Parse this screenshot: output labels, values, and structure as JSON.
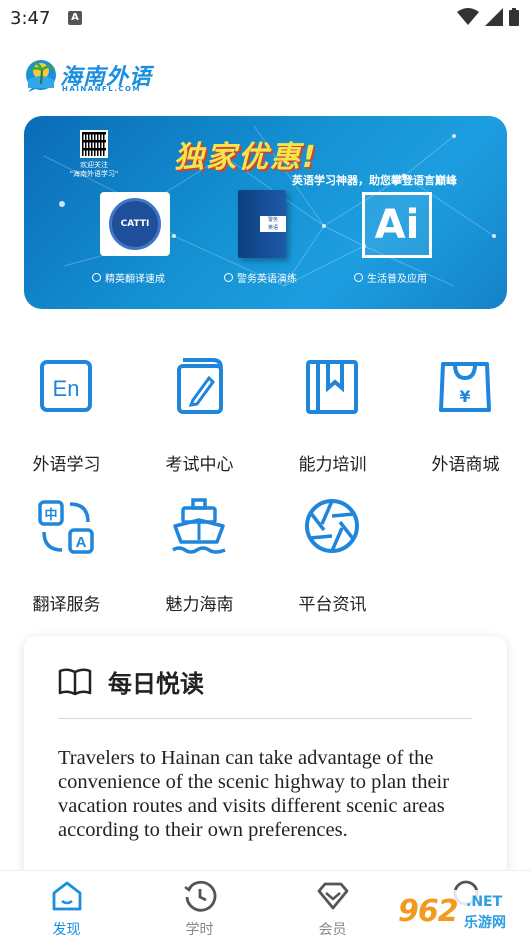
{
  "status_bar": {
    "time": "3:47",
    "notification_icon": "A"
  },
  "logo": {
    "name": "海南外语",
    "domain": "HAINANFL.COM"
  },
  "banner": {
    "qr_caption": "欢迎关注\n\"海南外语学习\"",
    "title": "独家优惠!",
    "slogan": "英语学习神器，助您攀登语言巅峰",
    "badge_text": "CATTI",
    "book_label": "警务\n英语",
    "ai_label": "Ai",
    "captions": [
      "精英翻译速成",
      "警务英语演练",
      "生活普及应用"
    ]
  },
  "menu": [
    {
      "label": "外语学习",
      "icon": "en-book-icon"
    },
    {
      "label": "考试中心",
      "icon": "exam-pencil-icon"
    },
    {
      "label": "能力培训",
      "icon": "bookmark-book-icon"
    },
    {
      "label": "外语商城",
      "icon": "shopping-bag-yen-icon"
    },
    {
      "label": "翻译服务",
      "icon": "translate-icon"
    },
    {
      "label": "魅力海南",
      "icon": "ship-icon"
    },
    {
      "label": "平台资讯",
      "icon": "aperture-icon"
    }
  ],
  "daily_reading": {
    "title": "每日悦读",
    "text": "Travelers to Hainan can take advantage of the convenience of the scenic highway to plan their vacation routes and visits different scenic areas according to their own preferences."
  },
  "bottom_nav": [
    {
      "label": "发现",
      "icon": "home-icon",
      "active": true
    },
    {
      "label": "学时",
      "icon": "history-clock-icon",
      "active": false
    },
    {
      "label": "会员",
      "icon": "diamond-icon",
      "active": false
    },
    {
      "label": "",
      "icon": "profile-icon",
      "active": false
    }
  ],
  "watermark": {
    "number": "962",
    "suffix": ".NET",
    "cn": "乐游网"
  },
  "colors": {
    "accent": "#1a8ee0",
    "icon_blue": "#1f86dc",
    "banner_bg": "#1491d2"
  }
}
